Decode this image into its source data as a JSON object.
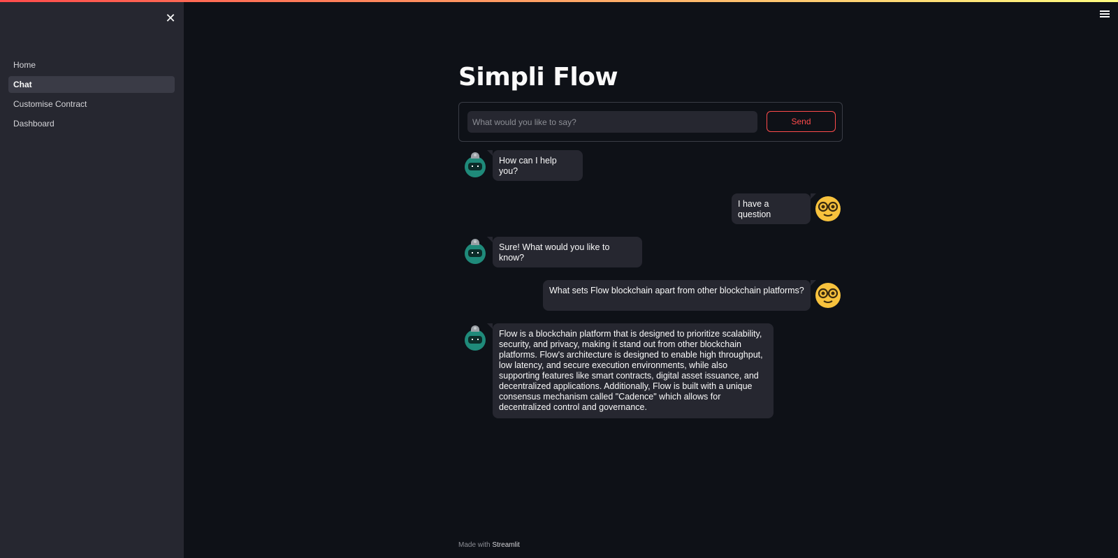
{
  "sidebar": {
    "close_icon": "close-icon",
    "items": [
      {
        "label": "Home",
        "active": false
      },
      {
        "label": "Chat",
        "active": true
      },
      {
        "label": "Customise Contract",
        "active": false
      },
      {
        "label": "Dashboard",
        "active": false
      }
    ]
  },
  "header": {
    "menu_icon": "hamburger-menu-icon"
  },
  "main": {
    "title": "Simpli Flow",
    "input": {
      "placeholder": "What would you like to say?",
      "value": ""
    },
    "send_label": "Send",
    "messages": [
      {
        "role": "bot",
        "avatar": "robot-avatar",
        "text": "How can I help you?"
      },
      {
        "role": "user",
        "avatar": "nerd-face-avatar",
        "text": "I have a question"
      },
      {
        "role": "bot",
        "avatar": "robot-avatar",
        "text": "Sure! What would you like to know?"
      },
      {
        "role": "user",
        "avatar": "nerd-face-avatar",
        "text": "What sets Flow blockchain apart from other blockchain platforms?"
      },
      {
        "role": "bot",
        "avatar": "robot-avatar",
        "text": "Flow is a blockchain platform that is designed to prioritize scalability, security, and privacy, making it stand out from other blockchain platforms. Flow's architecture is designed to enable high throughput, low latency, and secure execution environments, while also supporting features like smart contracts, digital asset issuance, and decentralized applications. Additionally, Flow is built with a unique consensus mechanism called \"Cadence\" which allows for decentralized control and governance."
      }
    ]
  },
  "footer": {
    "prefix": "Made with",
    "link": "Streamlit"
  },
  "colors": {
    "background": "#0e1117",
    "sidebar": "#262730",
    "accent": "#ff4b4b",
    "bubble": "#262730"
  }
}
